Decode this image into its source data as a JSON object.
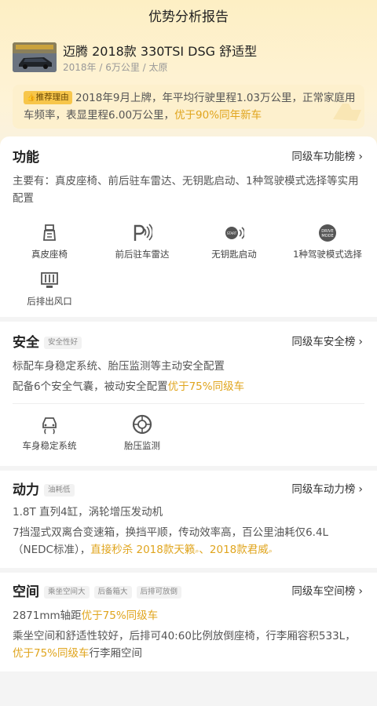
{
  "header": {
    "title": "优势分析报告"
  },
  "car": {
    "title": "迈腾 2018款 330TSI DSG 舒适型",
    "meta": "2018年 / 6万公里 / 太原"
  },
  "reason": {
    "badge": "推荐理由",
    "text": "2018年9月上牌，年平均行驶里程1.03万公里，正常家庭用车频率，表显里程6.00万公里，",
    "highlight": "优于90%同年新车"
  },
  "functions": {
    "title": "功能",
    "rank_label": "同级车功能榜",
    "desc": "主要有：真皮座椅、前后驻车雷达、无钥匙启动、1种驾驶模式选择等实用配置",
    "items": [
      {
        "label": "真皮座椅",
        "icon": "leather-seat-icon"
      },
      {
        "label": "前后驻车雷达",
        "icon": "parking-radar-icon"
      },
      {
        "label": "无钥匙启动",
        "icon": "keyless-start-icon"
      },
      {
        "label": "1种驾驶模式选择",
        "icon": "drive-mode-icon"
      },
      {
        "label": "后排出风口",
        "icon": "rear-vent-icon"
      }
    ]
  },
  "safety": {
    "title": "安全",
    "tag": "安全性好",
    "rank_label": "同级车安全榜",
    "desc1": "标配车身稳定系统、胎压监测等主动安全配置",
    "desc2_prefix": "配备6个安全气囊，被动安全配置",
    "desc2_highlight": "优于75%同级车",
    "items": [
      {
        "label": "车身稳定系统",
        "icon": "stability-control-icon"
      },
      {
        "label": "胎压监测",
        "icon": "tire-pressure-icon"
      }
    ]
  },
  "power": {
    "title": "动力",
    "tag": "油耗低",
    "rank_label": "同级车动力榜",
    "engine": "1.8T 直列4缸，涡轮增压发动机",
    "desc_prefix": "7挡湿式双离合变速箱，换挡平顺，传动效率高，百公里油耗仅6.4L（NEDC标准），",
    "desc_highlight1": "直接秒杀 2018款天籁",
    "desc_sep": "、",
    "desc_highlight2": "2018款君威"
  },
  "space": {
    "title": "空间",
    "tags": [
      "乘坐空间大",
      "后备箱大",
      "后排可放倒"
    ],
    "rank_label": "同级车空间榜",
    "wheelbase_prefix": "2871mm轴距",
    "wheelbase_highlight": "优于75%同级车",
    "desc_prefix": "乘坐空间和舒适性较好，后排可40:60比例放倒座椅，行李厢容积533L，",
    "desc_highlight": "优于75%同级车",
    "desc_suffix": "行李厢空间"
  },
  "colors": {
    "accent": "#e0a51e",
    "badge": "#f7c64b",
    "header_bg": "#fdefc4"
  }
}
